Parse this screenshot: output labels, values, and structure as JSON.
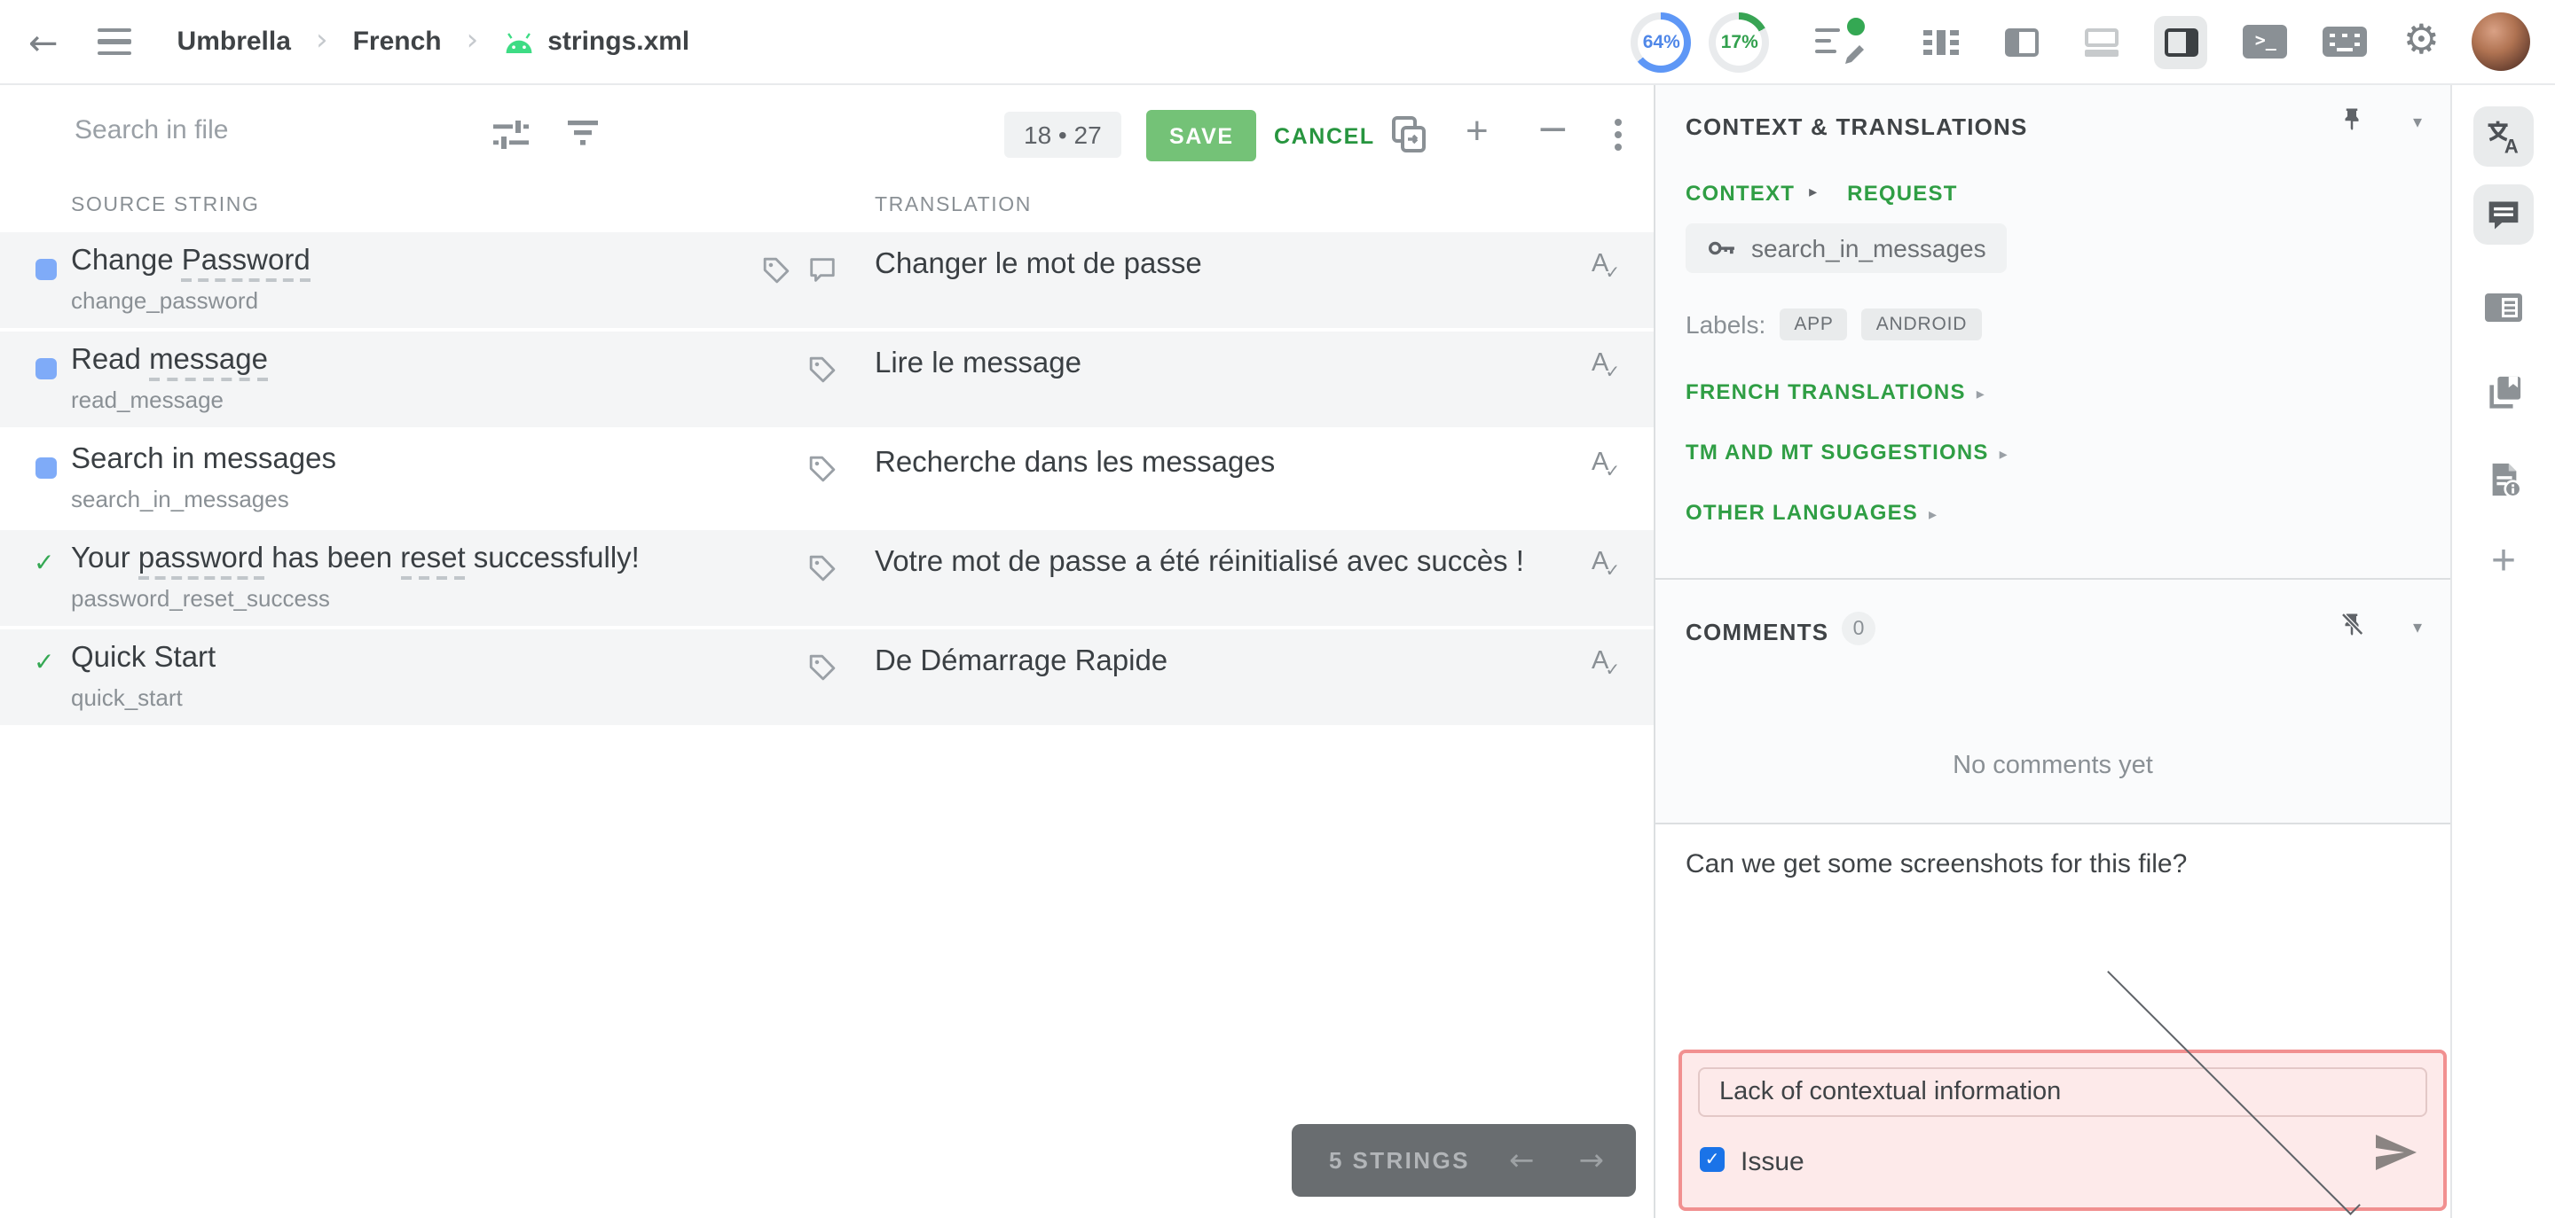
{
  "topbar": {
    "breadcrumb": [
      "Umbrella",
      "French",
      "strings.xml"
    ],
    "progress": [
      {
        "label": "64%",
        "value": 64,
        "color": "#5e97f6"
      },
      {
        "label": "17%",
        "value": 17,
        "color": "#38a454"
      }
    ]
  },
  "toolbar": {
    "search_placeholder": "Search in file",
    "counter": "18 • 27",
    "save": "SAVE",
    "cancel": "CANCEL"
  },
  "table": {
    "headers": {
      "source": "SOURCE STRING",
      "translation": "TRANSLATION"
    },
    "rows": [
      {
        "status": "untranslated",
        "source": "Change Password",
        "glossary": [
          "Password"
        ],
        "key": "change_password",
        "icons": [
          "tag",
          "comment"
        ],
        "translation": "Changer le mot de passe",
        "selected": false
      },
      {
        "status": "untranslated",
        "source": "Read message",
        "glossary": [
          "message"
        ],
        "key": "read_message",
        "icons": [
          "tag"
        ],
        "translation": "Lire le message",
        "selected": false
      },
      {
        "status": "untranslated",
        "source": "Search in messages",
        "glossary": [],
        "key": "search_in_messages",
        "icons": [
          "tag"
        ],
        "translation": "Recherche dans les messages",
        "selected": true
      },
      {
        "status": "approved",
        "source": "Your password has been reset successfully!",
        "glossary": [
          "password",
          "reset"
        ],
        "key": "password_reset_success",
        "icons": [
          "tag"
        ],
        "translation": "Votre mot de passe a été réinitialisé avec succès !",
        "selected": false
      },
      {
        "status": "approved",
        "source": "Quick Start",
        "glossary": [],
        "key": "quick_start",
        "icons": [
          "tag"
        ],
        "translation": "De Démarrage Rapide",
        "selected": false
      }
    ]
  },
  "footer": {
    "strings_count": "5 STRINGS"
  },
  "context_panel": {
    "title": "CONTEXT & TRANSLATIONS",
    "tabs": [
      {
        "label": "CONTEXT"
      },
      {
        "label": "REQUEST"
      }
    ],
    "string_key": "search_in_messages",
    "labels_caption": "Labels:",
    "labels": [
      "APP",
      "ANDROID"
    ],
    "links": [
      "FRENCH TRANSLATIONS",
      "TM AND MT SUGGESTIONS",
      "OTHER LANGUAGES"
    ]
  },
  "comments_panel": {
    "title": "COMMENTS",
    "count": "0",
    "empty": "No comments yet",
    "draft": "Can we get some screenshots for this file?",
    "issue": {
      "type": "Lack of contextual information",
      "checkbox_label": "Issue",
      "checked": true
    }
  },
  "colors": {
    "accent_green": "#2f9e44",
    "save_bg": "#74c277",
    "status_blue": "#7fabf8",
    "approved_green": "#34a853",
    "issue_bg": "#fdeaea",
    "issue_border": "#f19090",
    "checkbox_blue": "#1a73e8",
    "notification_green": "#34a853"
  }
}
